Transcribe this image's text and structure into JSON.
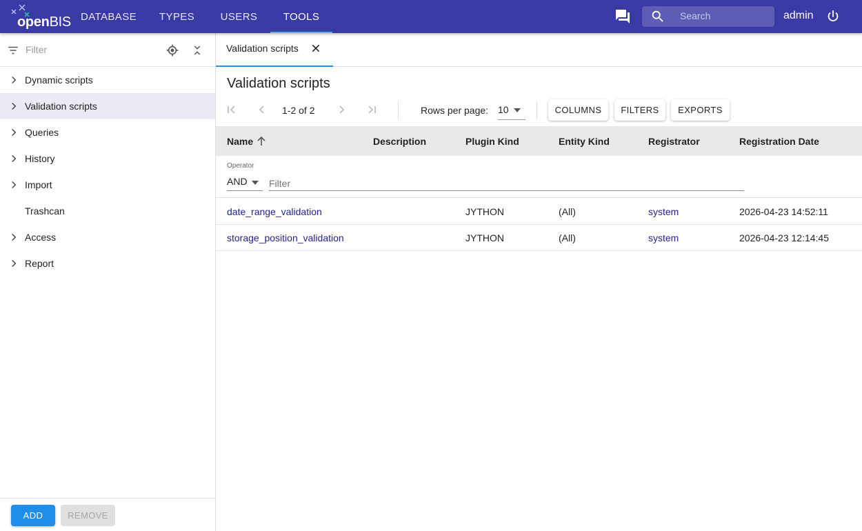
{
  "app": {
    "logo_prefix": "open",
    "logo_suffix": "BIS"
  },
  "topnav": {
    "items": [
      "DATABASE",
      "TYPES",
      "USERS",
      "TOOLS"
    ],
    "active": "TOOLS"
  },
  "search": {
    "placeholder": "Search"
  },
  "user": {
    "name": "admin"
  },
  "sidebar": {
    "filter_placeholder": "Filter",
    "items": [
      {
        "label": "Dynamic scripts",
        "expandable": true
      },
      {
        "label": "Validation scripts",
        "expandable": true,
        "selected": true
      },
      {
        "label": "Queries",
        "expandable": true
      },
      {
        "label": "History",
        "expandable": true
      },
      {
        "label": "Import",
        "expandable": true
      },
      {
        "label": "Trashcan",
        "expandable": false
      },
      {
        "label": "Access",
        "expandable": true
      },
      {
        "label": "Report",
        "expandable": true
      }
    ],
    "add_label": "ADD",
    "remove_label": "REMOVE"
  },
  "tabs": [
    {
      "label": "Validation scripts"
    }
  ],
  "page": {
    "title": "Validation scripts"
  },
  "pager": {
    "range": "1-2 of 2",
    "rows_label": "Rows per page:",
    "rows_value": "10"
  },
  "toolbar": {
    "columns_label": "COLUMNS",
    "filters_label": "FILTERS",
    "exports_label": "EXPORTS"
  },
  "table": {
    "headers": [
      "Name",
      "Description",
      "Plugin Kind",
      "Entity Kind",
      "Registrator",
      "Registration Date"
    ],
    "sort_column": "Name",
    "operator_label": "Operator",
    "operator_value": "AND",
    "filter_placeholder": "Filter",
    "rows": [
      {
        "name": "date_range_validation",
        "description": "",
        "plugin_kind": "JYTHON",
        "entity_kind": "(All)",
        "registrator": "system",
        "registration_date": "2026-04-23 14:52:11"
      },
      {
        "name": "storage_position_validation",
        "description": "",
        "plugin_kind": "JYTHON",
        "entity_kind": "(All)",
        "registrator": "system",
        "registration_date": "2026-04-23 12:14:45"
      }
    ]
  },
  "colors": {
    "topbar": "#3a3aa6",
    "accent": "#1e8ee8",
    "link": "#23238c",
    "selected_row": "#ebebf5",
    "header_bg": "#e9e9e9"
  }
}
